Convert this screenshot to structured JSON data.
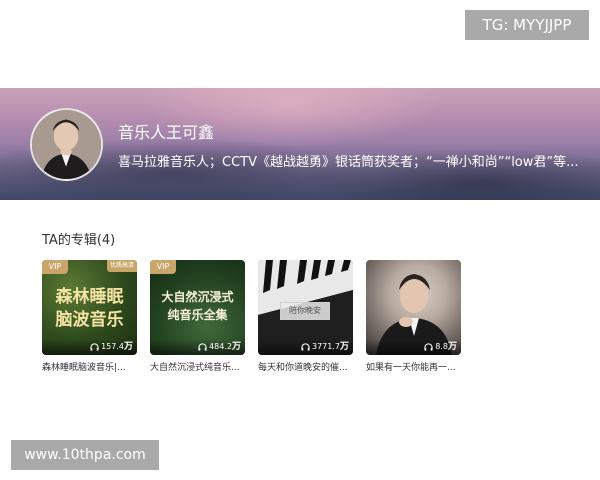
{
  "watermark_top": "TG: MYYJJPP",
  "watermark_bottom": "www.10thpa.com",
  "artist": {
    "name": "音乐人王可鑫",
    "description": "喜马拉雅音乐人；CCTV《越战越勇》银话筒获奖者；“一禅小和尚”“low君”等..."
  },
  "section_title": "TA的专辑(4)",
  "albums": [
    {
      "caption": "森林睡眠脑波音乐|...",
      "vip": "VIP",
      "quality": "优质高清",
      "cover_line1": "森林睡眠",
      "cover_line2": "脑波音乐",
      "plays": "157.4",
      "plays_unit": "万"
    },
    {
      "caption": "大自然沉浸式纯音乐...",
      "vip": "VIP",
      "cover_line1": "大自然沉浸式",
      "cover_line2": "纯音乐全集",
      "plays": "484.2",
      "plays_unit": "万"
    },
    {
      "caption": "每天和你道晚安的催...",
      "cover_label": "陪你晚安",
      "plays": "3771.7",
      "plays_unit": "万"
    },
    {
      "caption": "如果有一天你能再一...",
      "plays": "8.8",
      "plays_unit": "万"
    }
  ],
  "colors": {
    "vip_badge": "#c9a56a",
    "watermark_bg": "#a9a9a9"
  }
}
